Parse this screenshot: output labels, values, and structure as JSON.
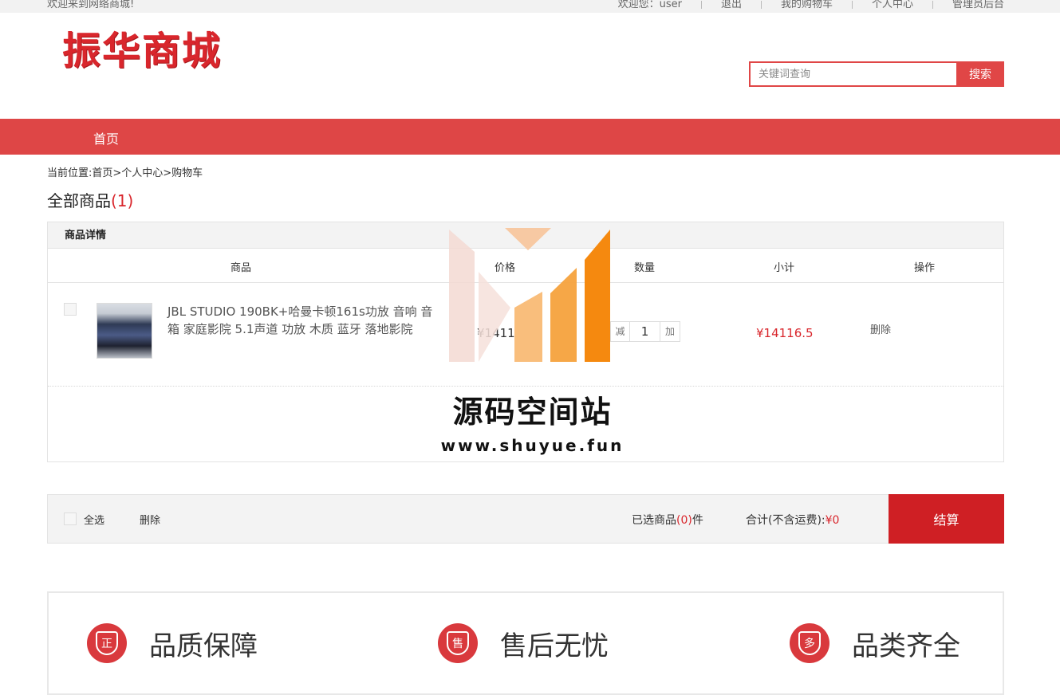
{
  "topbar": {
    "welcome": "欢迎来到网络商城!",
    "user_greeting": "欢迎您：user",
    "logout": "退出",
    "my_cart": "我的购物车",
    "personal_center": "个人中心",
    "admin": "管理员后台"
  },
  "header": {
    "logo_text": "振华商城",
    "search_placeholder": "关键词查询",
    "search_button": "搜索"
  },
  "nav": {
    "home": "首页"
  },
  "breadcrumb": "当前位置:首页>个人中心>购物车",
  "cart": {
    "title": "全部商品",
    "count": "(1)",
    "section_title": "商品详情",
    "columns": {
      "product": "商品",
      "price": "价格",
      "quantity": "数量",
      "subtotal": "小计",
      "operation": "操作"
    },
    "items": [
      {
        "name": "JBL STUDIO 190BK+哈曼卡顿161s功放 音响 音箱 家庭影院 5.1声道 功放 木质 蓝牙 落地影院",
        "price": "¥1411",
        "minus": "减",
        "quantity": "1",
        "plus": "加",
        "subtotal": "¥14116.5",
        "delete": "删除"
      }
    ]
  },
  "footer_bar": {
    "select_all": "全选",
    "delete": "删除",
    "selected_prefix": "已选商品",
    "selected_count": "(0)",
    "selected_suffix": "件",
    "total_label": "合计(不含运费):",
    "total_value": "¥0",
    "checkout": "结算"
  },
  "features": [
    {
      "icon_char": "正",
      "label": "品质保障"
    },
    {
      "icon_char": "售",
      "label": "售后无忧"
    },
    {
      "icon_char": "多",
      "label": "品类齐全"
    }
  ],
  "watermark": {
    "title": "源码空间站",
    "url": "www.shuyue.fun"
  },
  "colors": {
    "brand_red": "#de4646",
    "checkout_red": "#cf1f24",
    "price_red": "#d9262c"
  }
}
